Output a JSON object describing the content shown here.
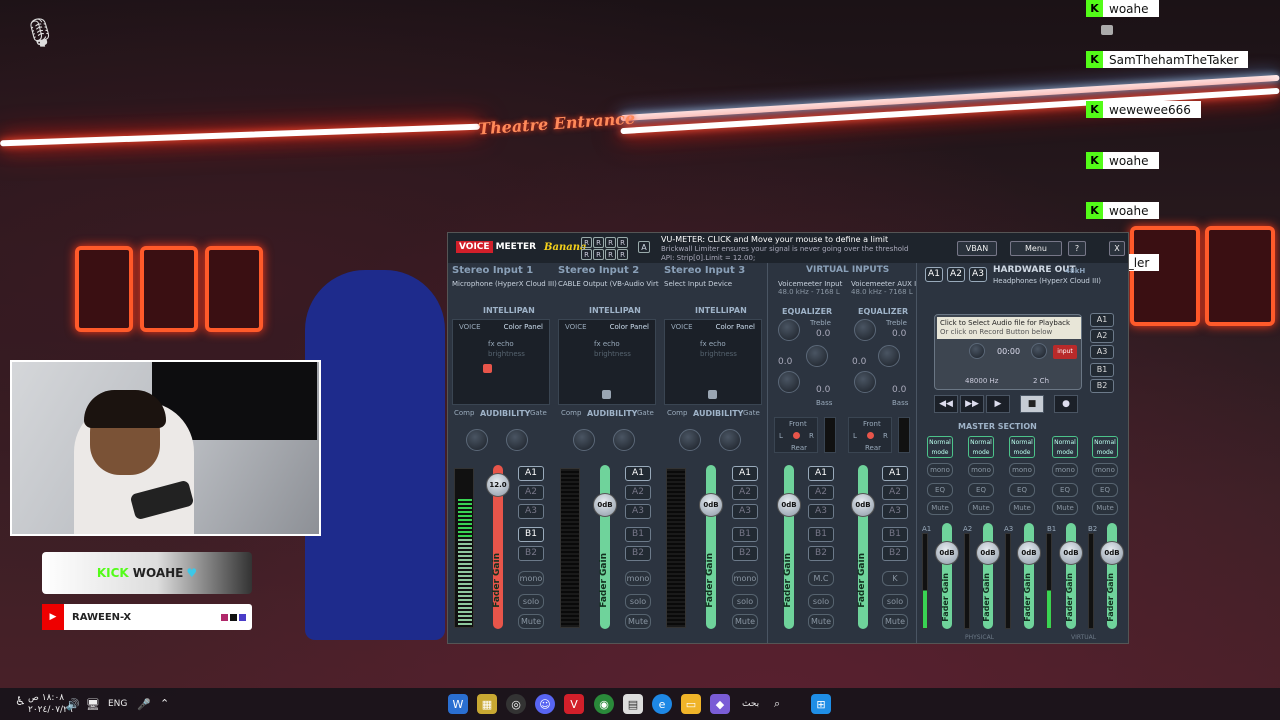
{
  "stream": {
    "banner_text": "WOAHE",
    "banner_kick": "KICK",
    "youtube_channel": "RAWEEN-X",
    "scene_sign": "Theatre Entrance"
  },
  "chat": [
    {
      "user": "woahe"
    },
    {
      "user": "SamThehamTheTaker"
    },
    {
      "user": "wewewee666"
    },
    {
      "user": "woahe"
    },
    {
      "user": "woahe"
    },
    {
      "user": "MR_ler"
    }
  ],
  "voicemeeter": {
    "logo_voice": "VOICE",
    "logo_meeter": "MEETER",
    "logo_banana": "Banana",
    "a_button": "A",
    "r_label": "R",
    "vu_title": "VU-METER: CLICK and Move your mouse to define a limit",
    "vu_line2": "Brickwall Limiter ensures your signal is never going over the threshold",
    "vu_line3": "API: Strip[0].Limit = 12.00;",
    "vban_label": "VBAN",
    "menu_label": "Menu",
    "help_label": "?",
    "close_label": "X",
    "strips": [
      {
        "title": "Stereo Input 1",
        "device": "Microphone (HyperX Cloud III)",
        "fader": "12.0"
      },
      {
        "title": "Stereo Input 2",
        "device": "CABLE Output (VB-Audio Virt",
        "fader": "0dB"
      },
      {
        "title": "Stereo Input 3",
        "device": "Select Input Device",
        "fader": "0dB"
      }
    ],
    "virtual_inputs_title": "VIRTUAL INPUTS",
    "virtual": [
      {
        "device": "Voicemeeter Input",
        "format": "48.0 kHz - 7168 L",
        "fader": "0dB"
      },
      {
        "device": "Voicemeeter AUX I",
        "format": "48.0 kHz - 7168 L",
        "fader": "0dB"
      }
    ],
    "intellipan": "INTELLIPAN",
    "voice": "VOICE",
    "color_panel": "Color Panel",
    "fx_echo": "fx echo",
    "brightness": "brightness",
    "lo": "Lo",
    "hi": "Hi",
    "comp": "Comp",
    "audibility": "AUDIBILITY",
    "gate": "Gate",
    "knob_zero": "0",
    "equalizer": "EQUALIZER",
    "treble": "Treble",
    "bass": "Bass",
    "eq_value": "0.0",
    "front": "Front",
    "rear": "Rear",
    "left": "L",
    "right": "R",
    "fader_gain": "Fader Gain",
    "bus_buttons": [
      "A1",
      "A2",
      "A3",
      "B1",
      "B2"
    ],
    "mono": "mono",
    "solo": "solo",
    "mute": "Mute",
    "mc": "M.C",
    "k": "K",
    "hw_out_title": "HARDWARE OUT",
    "hw_out_format": "48kH",
    "hw_out_device": "Headphones (HyperX Cloud III)",
    "out_buttons": [
      "A1",
      "A2",
      "A3"
    ],
    "tape_line1": "Click to Select Audio file for Playback",
    "tape_line2": "Or click on Record Button below",
    "tape_time": "00:00",
    "tape_rate": "48000 Hz",
    "tape_channels": "2 Ch",
    "tape_input": "input",
    "transport": [
      "◀◀",
      "▶▶",
      "▶",
      "■",
      "●"
    ],
    "master_section": "MASTER SECTION",
    "master_mode": "Normal mode",
    "master_labels": [
      "A1",
      "A2",
      "A3",
      "B1",
      "B2"
    ],
    "master_fader": "0dB",
    "eq": "EQ",
    "physical": "PHYSICAL",
    "virtual_label": "VIRTUAL"
  },
  "taskbar": {
    "lang": "ENG",
    "date": "٢٠٢٤/٠٧/٢٦",
    "time": "١٨:٠٨ ص",
    "search": "بحث"
  }
}
